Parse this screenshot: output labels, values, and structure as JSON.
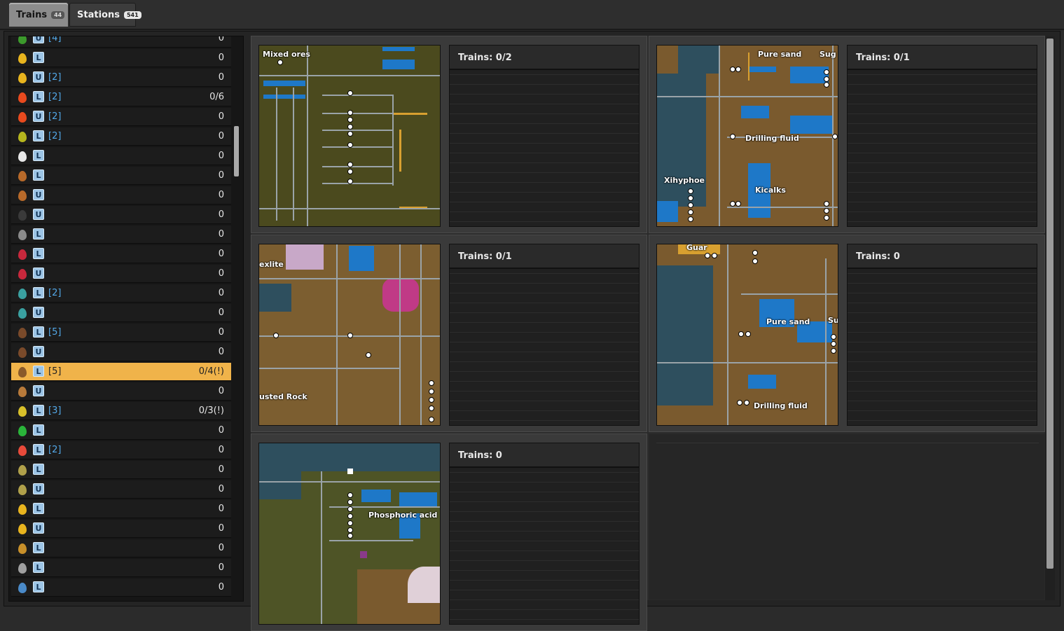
{
  "tabs": [
    {
      "label": "Trains",
      "badge": "44"
    },
    {
      "label": "Stations",
      "badge": "541"
    }
  ],
  "stations_list": [
    {
      "icon_color": "#3c9a2c",
      "icon": "green-item-icon",
      "tag": "U",
      "count": "[4]",
      "trains": "0"
    },
    {
      "icon_color": "#e8b41e",
      "icon": "yellow-fluid-icon",
      "tag": "L",
      "count": "",
      "trains": "0"
    },
    {
      "icon_color": "#e8b41e",
      "icon": "yellow-fluid-icon",
      "tag": "U",
      "count": "[2]",
      "trains": "0"
    },
    {
      "icon_color": "#e84a1e",
      "icon": "flame-fluid-icon",
      "tag": "L",
      "count": "[2]",
      "trains": "0/6"
    },
    {
      "icon_color": "#e84a1e",
      "icon": "flame-fluid-icon",
      "tag": "U",
      "count": "[2]",
      "trains": "0"
    },
    {
      "icon_color": "#b6b61e",
      "icon": "olive-fluid-icon",
      "tag": "L",
      "count": "[2]",
      "trains": "0"
    },
    {
      "icon_color": "#e8e8e8",
      "icon": "white-fluid-icon",
      "tag": "L",
      "count": "",
      "trains": "0"
    },
    {
      "icon_color": "#b86a2a",
      "icon": "brown-fluid-icon",
      "tag": "L",
      "count": "",
      "trains": "0"
    },
    {
      "icon_color": "#b86a2a",
      "icon": "brown-fluid-icon",
      "tag": "U",
      "count": "",
      "trains": "0"
    },
    {
      "icon_color": "#3a3a3a",
      "icon": "dark-fluid-icon",
      "tag": "U",
      "count": "",
      "trains": "0"
    },
    {
      "icon_color": "#8a8a8a",
      "icon": "gray-flask-icon",
      "tag": "L",
      "count": "",
      "trains": "0"
    },
    {
      "icon_color": "#c8283c",
      "icon": "capsule-icon",
      "tag": "L",
      "count": "",
      "trains": "0"
    },
    {
      "icon_color": "#c8283c",
      "icon": "capsule-icon",
      "tag": "U",
      "count": "",
      "trains": "0"
    },
    {
      "icon_color": "#3aa0a0",
      "icon": "teal-fluid-icon",
      "tag": "L",
      "count": "[2]",
      "trains": "0"
    },
    {
      "icon_color": "#3aa0a0",
      "icon": "teal-fluid-icon",
      "tag": "U",
      "count": "",
      "trains": "0"
    },
    {
      "icon_color": "#7a4a2a",
      "icon": "dark-brown-fluid-icon",
      "tag": "L",
      "count": "[5]",
      "trains": "0"
    },
    {
      "icon_color": "#7a4a2a",
      "icon": "dark-brown-fluid-icon",
      "tag": "U",
      "count": "",
      "trains": "0"
    },
    {
      "icon_color": "#8a5a2a",
      "icon": "dark-brown-fluid-icon",
      "tag": "L",
      "count": "[5]",
      "trains": "0/4(!)",
      "selected": true
    },
    {
      "icon_color": "#b87a3a",
      "icon": "brown-fluid-icon",
      "tag": "U",
      "count": "",
      "trains": "0"
    },
    {
      "icon_color": "#d8c02a",
      "icon": "yellow-cluster-icon",
      "tag": "L",
      "count": "[3]",
      "trains": "0/3(!)"
    },
    {
      "icon_color": "#2ab43a",
      "icon": "green-fluid-icon",
      "tag": "L",
      "count": "",
      "trains": "0"
    },
    {
      "icon_color": "#e84a3a",
      "icon": "red-fluid-icon",
      "tag": "L",
      "count": "[2]",
      "trains": "0"
    },
    {
      "icon_color": "#b0a04a",
      "icon": "khaki-fluid-icon",
      "tag": "L",
      "count": "",
      "trains": "0"
    },
    {
      "icon_color": "#b0a04a",
      "icon": "khaki-fluid-icon",
      "tag": "U",
      "count": "",
      "trains": "0"
    },
    {
      "icon_color": "#e8b41e",
      "icon": "yellow-fluid-icon",
      "tag": "L",
      "count": "",
      "trains": "0"
    },
    {
      "icon_color": "#e8b41e",
      "icon": "yellow-fluid-icon",
      "tag": "U",
      "count": "",
      "trains": "0"
    },
    {
      "icon_color": "#c8902a",
      "icon": "amber-fluid-icon",
      "tag": "L",
      "count": "",
      "trains": "0"
    },
    {
      "icon_color": "#a0a0a0",
      "icon": "gray-fluid-icon",
      "tag": "L",
      "count": "",
      "trains": "0"
    },
    {
      "icon_color": "#4a8ac8",
      "icon": "blue-fluid-icon",
      "tag": "L",
      "count": "",
      "trains": "0"
    }
  ],
  "cells": [
    {
      "trains": "Trains: 0/2",
      "labels": [
        "Mixed ores"
      ]
    },
    {
      "trains": "Trains: 0/1",
      "labels": [
        "Pure sand",
        "Sug",
        "Drilling fluid",
        "Xihyphoe",
        "Kicalks"
      ]
    },
    {
      "trains": "Trains: 0/1",
      "labels": [
        "exlite",
        "usted Rock"
      ]
    },
    {
      "trains": "Trains: 0",
      "labels": [
        "Guar",
        "Pure sand",
        "Su",
        "Drilling fluid"
      ]
    },
    {
      "trains": "Trains: 0",
      "labels": [
        "Phosphoric acid"
      ]
    }
  ]
}
